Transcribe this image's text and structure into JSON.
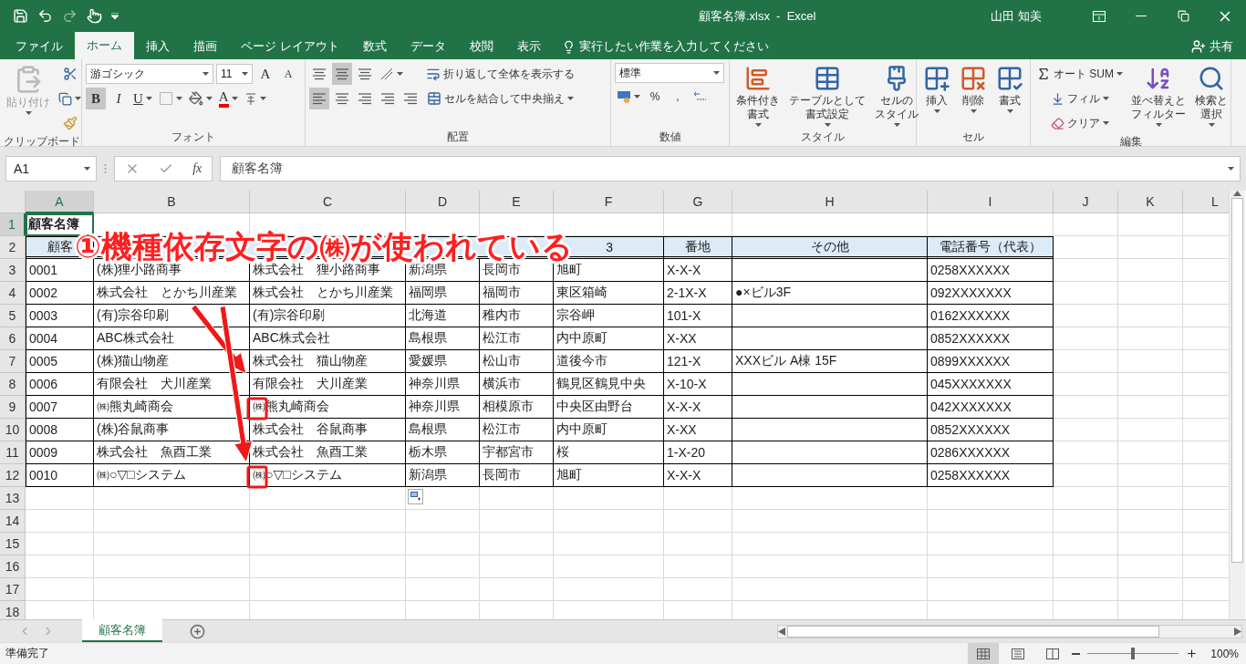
{
  "title_bar": {
    "title": "顧客名簿.xlsx  -  Excel",
    "user": "山田 知美"
  },
  "tabs": [
    {
      "label": "ファイル",
      "selected": false
    },
    {
      "label": "ホーム",
      "selected": true
    },
    {
      "label": "挿入",
      "selected": false
    },
    {
      "label": "描画",
      "selected": false
    },
    {
      "label": "ページ レイアウト",
      "selected": false
    },
    {
      "label": "数式",
      "selected": false
    },
    {
      "label": "データ",
      "selected": false
    },
    {
      "label": "校閲",
      "selected": false
    },
    {
      "label": "表示",
      "selected": false
    }
  ],
  "tell_me": {
    "placeholder": "実行したい作業を入力してください"
  },
  "share": "共有",
  "ribbon": {
    "clipboard": {
      "label": "クリップボード",
      "paste": {
        "label": "貼り付け",
        "disabled": true
      }
    },
    "font": {
      "label": "フォント",
      "font_name": "游ゴシック",
      "font_size": "11",
      "grow": "A",
      "shrink": "A",
      "bold": {
        "label": "B",
        "on": true
      },
      "italic": {
        "label": "I",
        "on": false
      },
      "underline": {
        "label": "U",
        "on": false
      },
      "font_color": "A"
    },
    "alignment": {
      "label": "配置",
      "vertical": [
        {
          "selected": false
        },
        {
          "selected": true
        },
        {
          "selected": false
        }
      ],
      "horizontal": [
        {
          "selected": true
        },
        {
          "selected": false
        },
        {
          "selected": false
        }
      ],
      "wrap_text": "折り返して全体を表示する",
      "merge_center": "セルを結合して中央揃え"
    },
    "number": {
      "label": "数値",
      "format": "標準",
      "percent": "%",
      "comma": ","
    },
    "styles": {
      "label": "スタイル",
      "buttons": [
        [
          "条件付き",
          "書式"
        ],
        [
          "テーブルとして",
          "書式設定"
        ],
        [
          "セルの",
          "スタイル"
        ]
      ]
    },
    "cells": {
      "label": "セル",
      "buttons": [
        "挿入",
        "削除",
        "書式"
      ]
    },
    "editing": {
      "label": "編集",
      "autosum": "オート SUM",
      "fill": "フィル",
      "clear": "クリア",
      "sort": [
        "並べ替えと",
        "フィルター"
      ],
      "find": [
        "検索と",
        "選択"
      ]
    }
  },
  "formula_bar": {
    "name_box": "A1",
    "fx": "fx",
    "value": "顧客名簿"
  },
  "sheet": {
    "columns": [
      {
        "label": "A",
        "selected": true
      },
      {
        "label": "B",
        "selected": false
      },
      {
        "label": "C",
        "selected": false
      },
      {
        "label": "D",
        "selected": false
      },
      {
        "label": "E",
        "selected": false
      },
      {
        "label": "F",
        "selected": false
      },
      {
        "label": "G",
        "selected": false
      },
      {
        "label": "H",
        "selected": false
      },
      {
        "label": "I",
        "selected": false
      },
      {
        "label": "J",
        "selected": false
      },
      {
        "label": "K",
        "selected": false
      },
      {
        "label": "L",
        "selected": false
      }
    ],
    "rows": [
      {
        "header": "1",
        "kind": "title",
        "selected": true,
        "cells": [
          "顧客名簿"
        ]
      },
      {
        "header": "2",
        "kind": "header",
        "selected": false,
        "cells": [
          "顧客",
          null,
          null,
          null,
          null,
          "3",
          "番地",
          "その他",
          "電話番号（代表）"
        ]
      },
      {
        "header": "3",
        "kind": "data",
        "selected": false,
        "cells": [
          "0001",
          "(株)狸小路商事",
          "株式会社　狸小路商事",
          "新潟県",
          "長岡市",
          "旭町",
          "X-X-X",
          null,
          "0258XXXXXX"
        ]
      },
      {
        "header": "4",
        "kind": "data",
        "selected": false,
        "cells": [
          "0002",
          "株式会社　とかち川産業",
          "株式会社　とかち川産業",
          "福岡県",
          "福岡市",
          "東区箱崎",
          "2-1X-X",
          "●×ビル3F",
          "092XXXXXXX"
        ]
      },
      {
        "header": "5",
        "kind": "data",
        "selected": false,
        "cells": [
          "0003",
          "(有)宗谷印刷",
          "(有)宗谷印刷",
          "北海道",
          "稚内市",
          "宗谷岬",
          "101-X",
          null,
          "0162XXXXXX"
        ]
      },
      {
        "header": "6",
        "kind": "data",
        "selected": false,
        "cells": [
          "0004",
          "ABC株式会社",
          "ABC株式会社",
          "島根県",
          "松江市",
          "内中原町",
          "X-XX",
          null,
          "0852XXXXXX"
        ]
      },
      {
        "header": "7",
        "kind": "data",
        "selected": false,
        "cells": [
          "0005",
          "(株)猫山物産",
          "株式会社　猫山物産",
          "愛媛県",
          "松山市",
          "道後今市",
          "121-X",
          "XXXビル A棟 15F",
          "0899XXXXXX"
        ]
      },
      {
        "header": "8",
        "kind": "data",
        "selected": false,
        "cells": [
          "0006",
          "有限会社　犬川産業",
          "有限会社　犬川産業",
          "神奈川県",
          "横浜市",
          "鶴見区鶴見中央",
          "X-10-X",
          null,
          "045XXXXXXX"
        ]
      },
      {
        "header": "9",
        "kind": "data",
        "selected": false,
        "cells": [
          "0007",
          "㈱熊丸崎商会",
          "㈱熊丸崎商会",
          "神奈川県",
          "相模原市",
          "中央区由野台",
          "X-X-X",
          null,
          "042XXXXXXX"
        ]
      },
      {
        "header": "10",
        "kind": "data",
        "selected": false,
        "cells": [
          "0008",
          "(株)谷鼠商事",
          "株式会社　谷鼠商事",
          "島根県",
          "松江市",
          "内中原町",
          "X-XX",
          null,
          "0852XXXXXX"
        ]
      },
      {
        "header": "11",
        "kind": "data",
        "selected": false,
        "cells": [
          "0009",
          "株式会社　魚酉工業",
          "株式会社　魚酉工業",
          "栃木県",
          "宇都宮市",
          "桜",
          "1-X-20",
          null,
          "0286XXXXXX"
        ]
      },
      {
        "header": "12",
        "kind": "data",
        "selected": false,
        "cells": [
          "0010",
          "㈱○▽□システム",
          "㈱○▽□システム",
          "新潟県",
          "長岡市",
          "旭町",
          "X-X-X",
          null,
          "0258XXXXXX"
        ]
      },
      {
        "header": "13",
        "kind": "blank",
        "selected": false
      },
      {
        "header": "14",
        "kind": "blank",
        "selected": false
      },
      {
        "header": "15",
        "kind": "blank",
        "selected": false
      },
      {
        "header": "16",
        "kind": "blank",
        "selected": false
      },
      {
        "header": "17",
        "kind": "blank",
        "selected": false
      },
      {
        "header": "18",
        "kind": "blank",
        "selected": false
      }
    ]
  },
  "annotation": {
    "text": "①機種依存文字の㈱が使われている"
  },
  "sheet_tabs": [
    {
      "label": "顧客名簿",
      "selected": true
    }
  ],
  "status_bar": {
    "text": "準備完了",
    "views": [
      {
        "selected": true
      },
      {
        "selected": false
      },
      {
        "selected": false
      }
    ],
    "zoom": {
      "level": 0.5,
      "reading": "100%"
    }
  }
}
